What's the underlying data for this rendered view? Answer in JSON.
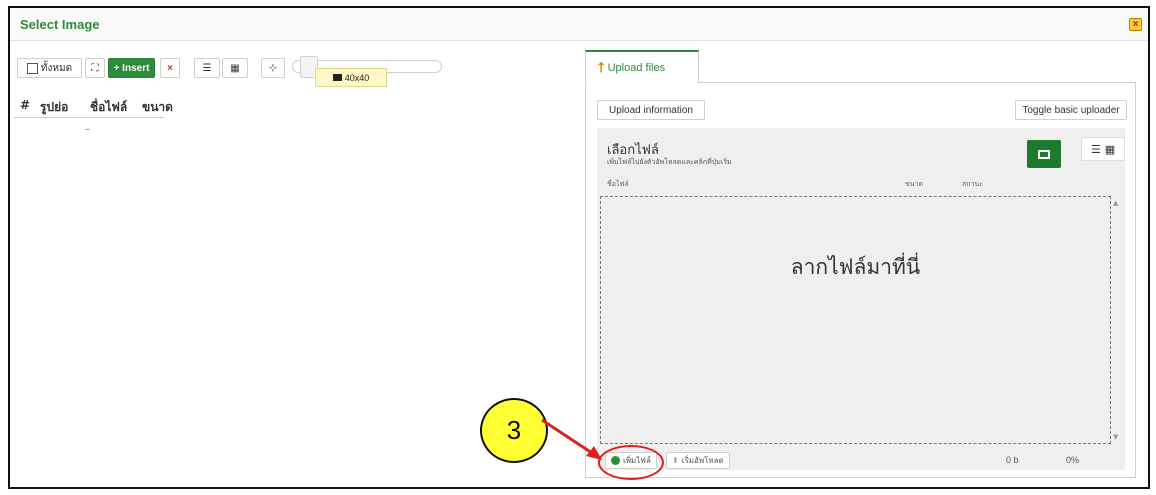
{
  "dialog": {
    "title": "Select Image",
    "close_label": "×"
  },
  "toolbar": {
    "select_all_label": "ทั้งหมด",
    "expand_label": "⛶",
    "insert_label": "+ Insert",
    "delete_label": "×",
    "list_view_label": "☰",
    "grid_view_label": "▦",
    "fit_label": "⊹",
    "thumb_size_label": "40x40"
  },
  "table": {
    "columns": [
      "#",
      "รูปย่อ",
      "ชื่อไฟล์",
      "ขนาด"
    ],
    "empty_row": "–"
  },
  "upload": {
    "tab_label": "Upload files",
    "info_button": "Upload information",
    "toggle_button": "Toggle basic uploader",
    "choose_title": "เลือกไฟล์",
    "choose_sub": "เพิ่มไฟล์ไปยังตัวอัพโหลดและคลิกที่ปุ่มเริ่ม",
    "col_filename": "ชื่อไฟล์",
    "col_size": "ขนาด",
    "col_status": "สถานะ",
    "drop_text": "ลากไฟล์มาที่นี่",
    "add_file_button": "เพิ่มไฟล์",
    "start_upload_button": "เริ่มอัพโหลด",
    "total_size": "0 b",
    "total_percent": "0%"
  },
  "annotation": {
    "step_number": "3"
  }
}
